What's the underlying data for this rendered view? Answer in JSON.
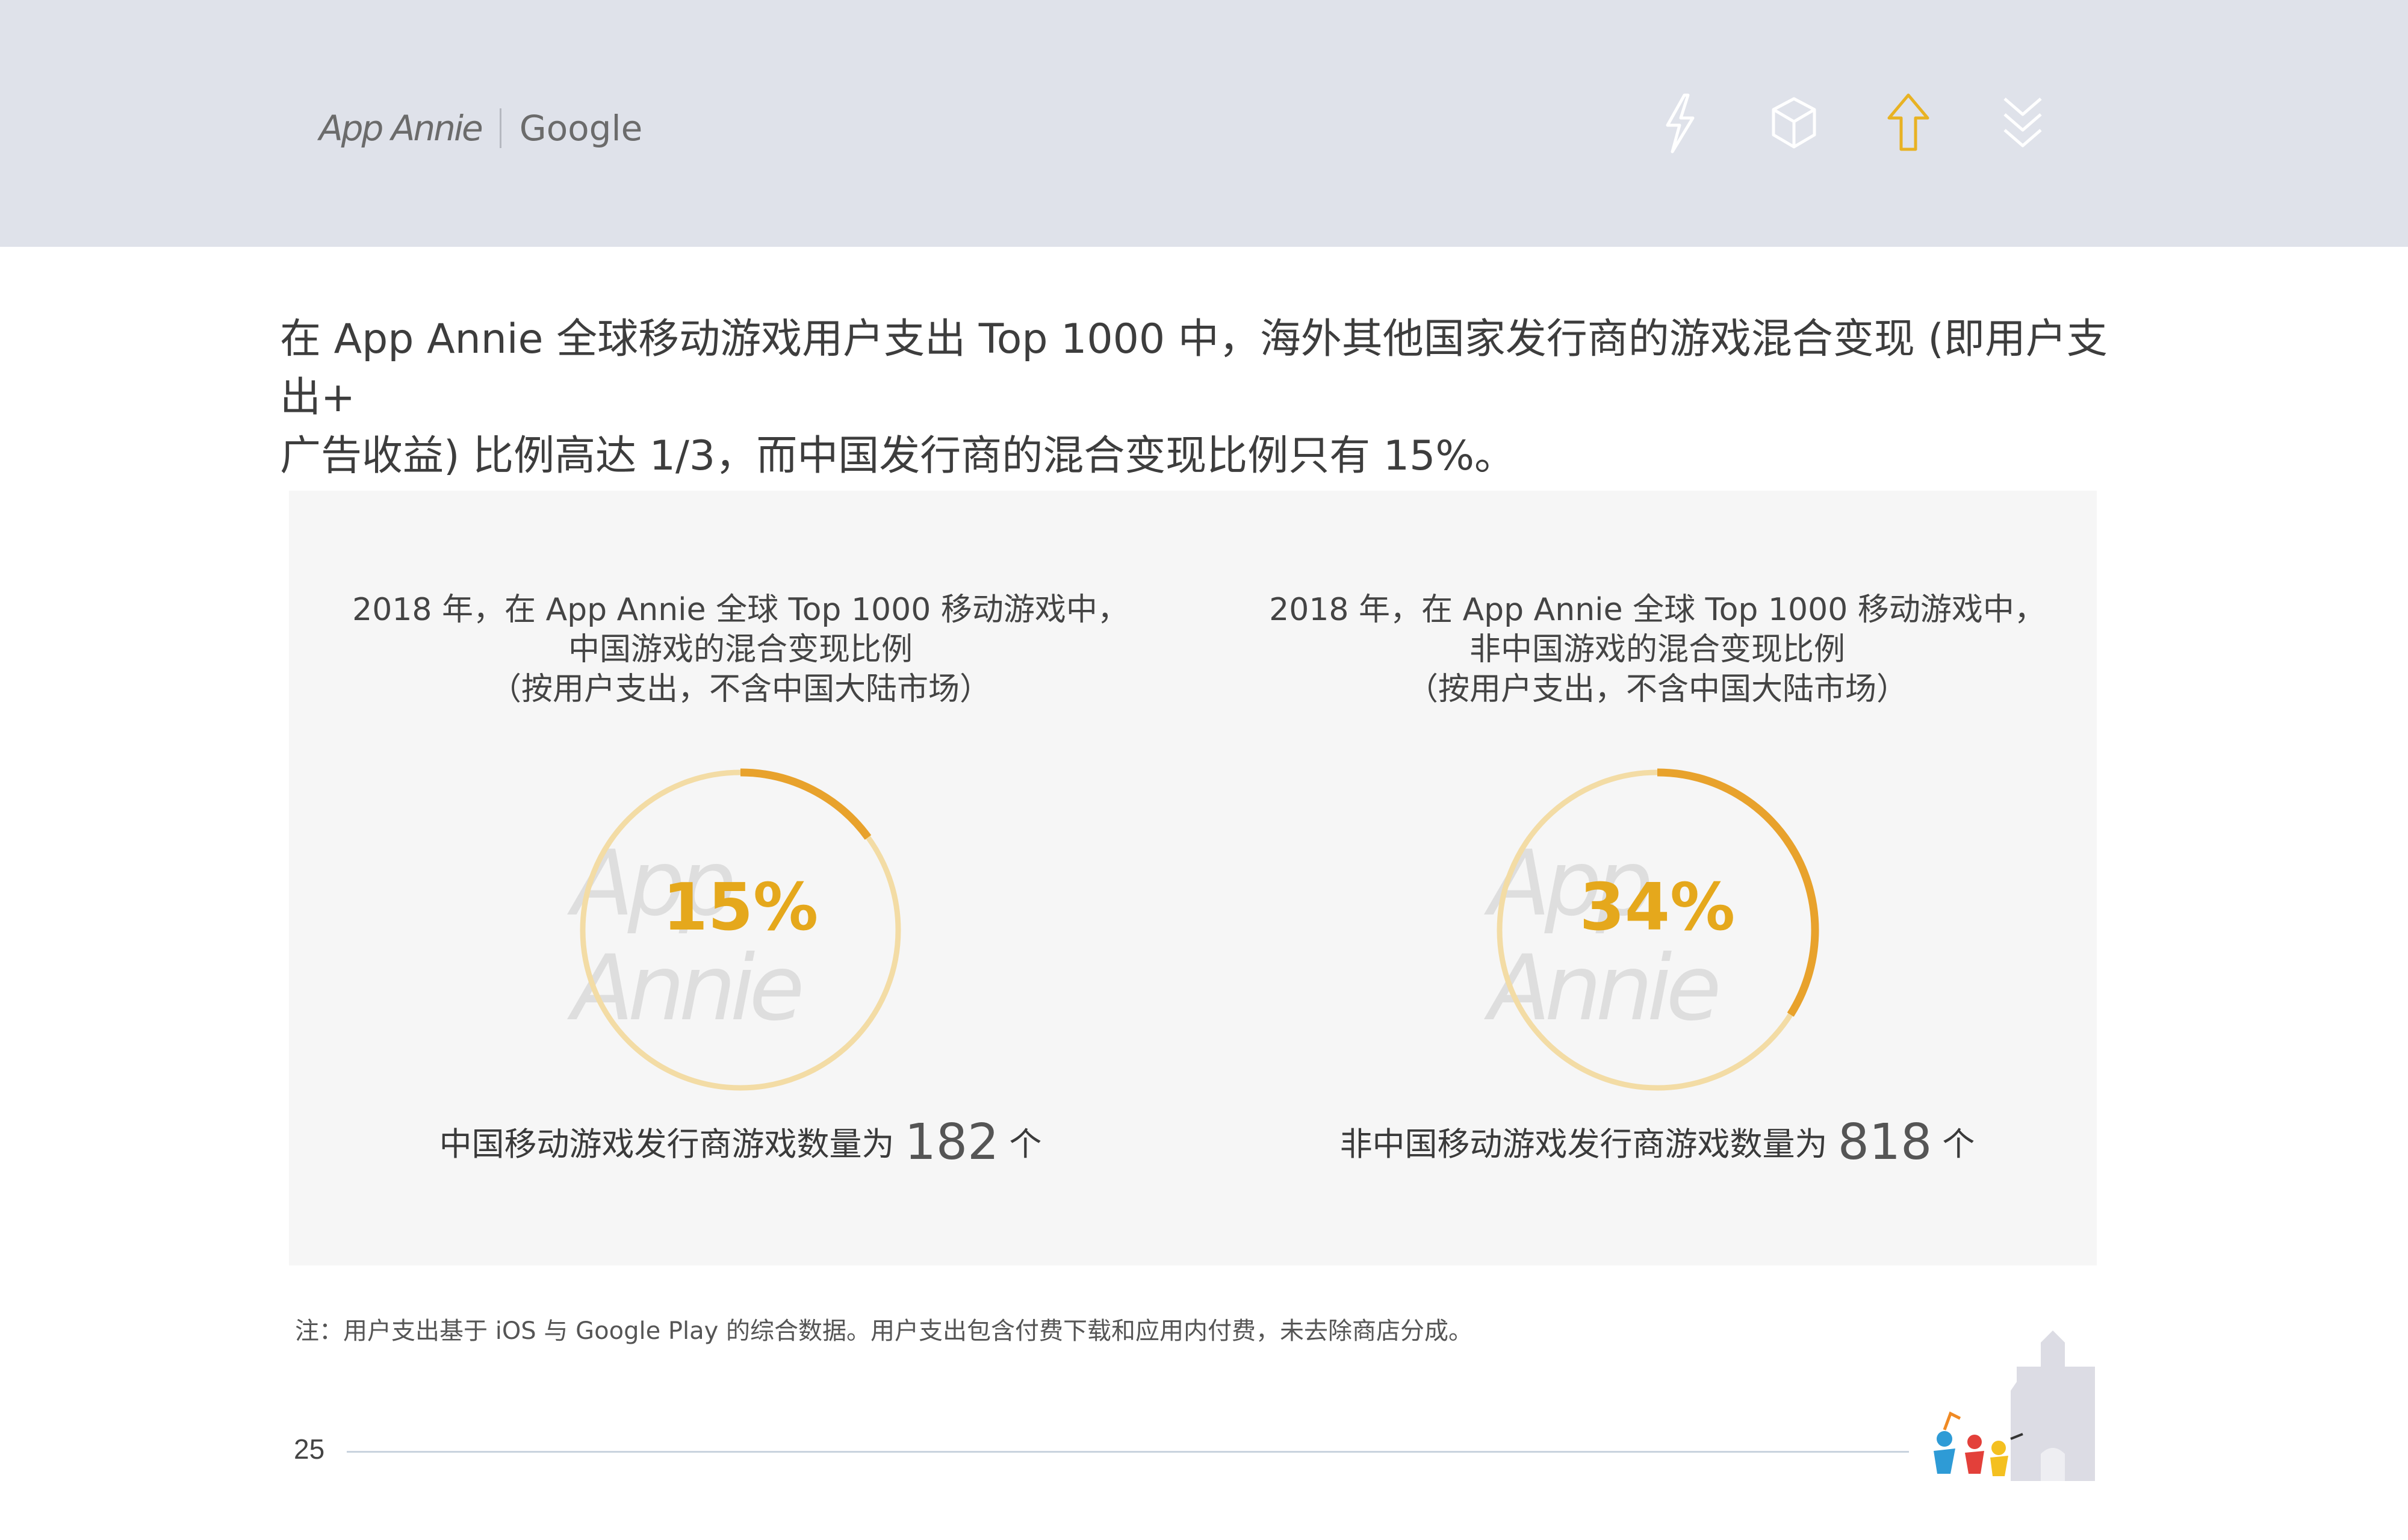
{
  "header": {
    "brand_appannie": "App Annie",
    "brand_google": "Google",
    "nav_icons": [
      {
        "name": "lightning-icon",
        "color": "#ffffff",
        "active": false
      },
      {
        "name": "cube-icon",
        "color": "#ffffff",
        "active": false
      },
      {
        "name": "arrow-up-icon",
        "color": "#e8b223",
        "active": true
      },
      {
        "name": "double-chevron-down-icon",
        "color": "#ffffff",
        "active": false
      }
    ]
  },
  "intro": {
    "line1": "在 App Annie 全球移动游戏用户支出 Top 1000 中，海外其他国家发行商的游戏混合变现 (即用户支出+",
    "line2": "广告收益) 比例高达 1/3，而中国发行商的混合变现比例只有 15%。"
  },
  "chart_data": [
    {
      "type": "pie",
      "title_lines": [
        "2018 年，在 App Annie 全球 Top 1000 移动游戏中，",
        "中国游戏的混合变现比例",
        "（按用户支出，不含中国大陆市场）"
      ],
      "value_percent": 15,
      "value_label": "15%",
      "watermark": "App Annie",
      "count_text": "中国移动游戏发行商游戏数量为",
      "count_value": "182",
      "count_unit": "个",
      "colors": {
        "filled": "#e8a22c",
        "track": "#f3dca5",
        "label": "#e5a81c"
      }
    },
    {
      "type": "pie",
      "title_lines": [
        "2018 年，在 App Annie 全球 Top 1000 移动游戏中，",
        "非中国游戏的混合变现比例",
        "（按用户支出，不含中国大陆市场）"
      ],
      "value_percent": 34,
      "value_label": "34%",
      "watermark": "App Annie",
      "count_text": "非中国移动游戏发行商游戏数量为",
      "count_value": "818",
      "count_unit": "个",
      "colors": {
        "filled": "#e8a22c",
        "track": "#f3dca5",
        "label": "#e5a81c"
      }
    }
  ],
  "footer": {
    "note": "注：用户支出基于 iOS 与 Google Play 的综合数据。用户支出包含付费下载和应用内付费，未去除商店分成。",
    "page_number": "25"
  }
}
